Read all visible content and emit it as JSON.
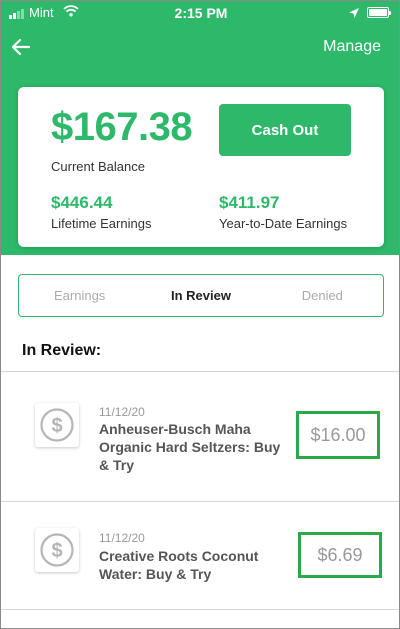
{
  "status_bar": {
    "carrier": "Mint",
    "time": "2:15 PM"
  },
  "nav": {
    "manage_label": "Manage"
  },
  "balance_card": {
    "current_balance": "$167.38",
    "current_balance_label": "Current Balance",
    "cash_out_label": "Cash Out",
    "lifetime_earnings": "$446.44",
    "lifetime_earnings_label": "Lifetime Earnings",
    "ytd_earnings": "$411.97",
    "ytd_earnings_label": "Year-to-Date Earnings"
  },
  "tabs": [
    {
      "label": "Earnings",
      "active": false
    },
    {
      "label": "In Review",
      "active": true
    },
    {
      "label": "Denied",
      "active": false
    }
  ],
  "section_title": "In Review:",
  "items": [
    {
      "date": "11/12/20",
      "title": "Anheuser-Busch Maha Organic Hard Seltzers: Buy & Try",
      "amount": "$16.00",
      "icon": "dollar-circle-icon"
    },
    {
      "date": "11/12/20",
      "title": "Creative Roots Coconut Water: Buy & Try",
      "amount": "$6.69",
      "icon": "dollar-circle-icon"
    }
  ],
  "colors": {
    "brand_green": "#2db86a",
    "highlight_box": "#2aa94a"
  }
}
